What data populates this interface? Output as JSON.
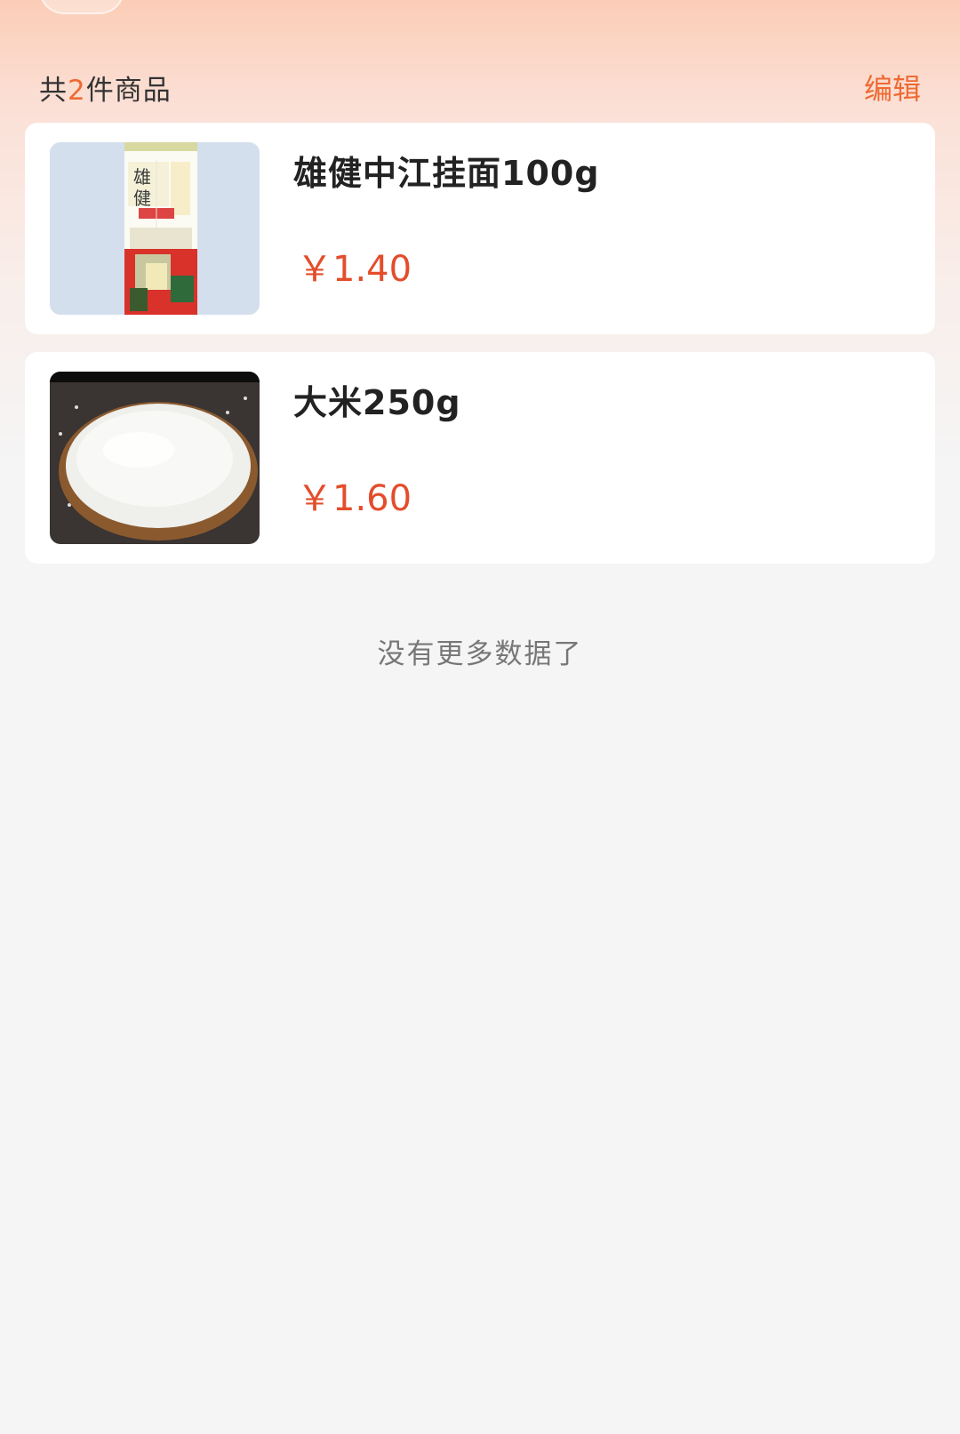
{
  "summary": {
    "prefix": "共",
    "count": "2",
    "suffix": "件商品",
    "edit_label": "编辑"
  },
  "products": [
    {
      "name": "雄健中江挂面100g",
      "price": "￥1.40",
      "image_icon": "noodle-package-image"
    },
    {
      "name": "大米250g",
      "price": "￥1.60",
      "image_icon": "rice-bowl-image"
    }
  ],
  "footer": {
    "no_more_text": "没有更多数据了"
  },
  "colors": {
    "accent": "#ee6a33",
    "price": "#e34d2c"
  }
}
